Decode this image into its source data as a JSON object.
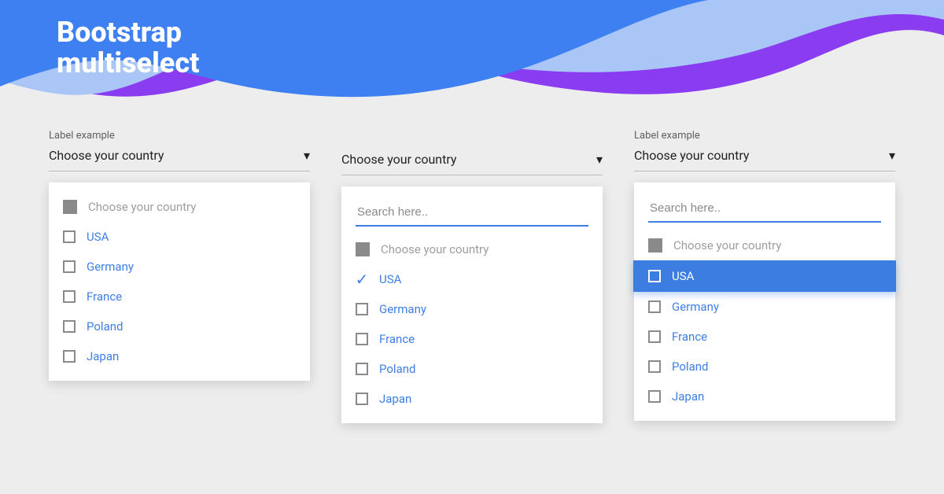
{
  "title_line1": "Bootstrap",
  "title_line2": "multiselect",
  "label_text": "Label example",
  "select_placeholder": "Choose your country",
  "search_placeholder": "Search here..",
  "countries": [
    "USA",
    "Germany",
    "France",
    "Poland",
    "Japan"
  ],
  "colors": {
    "accent": "#3f7fe5",
    "hero_blue": "#3e7ff1",
    "hero_purple": "#8a3cf0"
  }
}
